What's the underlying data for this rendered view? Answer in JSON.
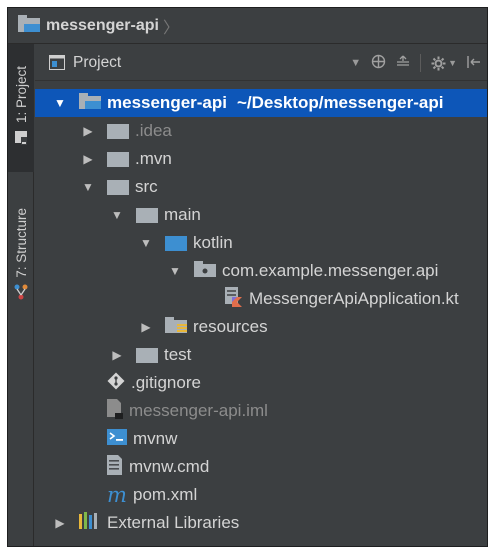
{
  "breadcrumb": {
    "project_name": "messenger-api"
  },
  "toolstrip": {
    "project_tab": "1: Project",
    "structure_tab": "7: Structure"
  },
  "panel": {
    "title": "Project"
  },
  "tree": {
    "root": {
      "name": "messenger-api",
      "path": "~/Desktop/messenger-api"
    },
    "idea": ".idea",
    "mvn": ".mvn",
    "src": "src",
    "main": "main",
    "kotlin": "kotlin",
    "package": "com.example.messenger.api",
    "app_file": "MessengerApiApplication.kt",
    "resources": "resources",
    "test": "test",
    "gitignore": ".gitignore",
    "iml": "messenger-api.iml",
    "mvnw": "mvnw",
    "mvnw_cmd": "mvnw.cmd",
    "pom": "pom.xml",
    "external": "External Libraries"
  },
  "colors": {
    "background": "#3c3f41",
    "selection": "#0d56b8",
    "folder_blue": "#3d8fd1",
    "folder_grey": "#a9b0b6"
  }
}
